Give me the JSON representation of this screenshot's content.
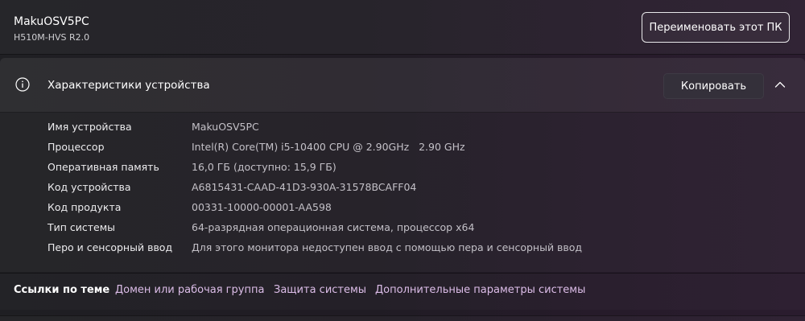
{
  "device": {
    "name": "MakuOSV5PC",
    "model": "H510M-HVS R2.0",
    "rename_label": "Переименовать этот ПК"
  },
  "specs": {
    "title": "Характеристики устройства",
    "copy_label": "Копировать",
    "expanded": true,
    "rows": [
      {
        "label": "Имя устройства",
        "value": "MakuOSV5PC"
      },
      {
        "label": "Процессор",
        "value": "Intel(R) Core(TM) i5-10400 CPU @ 2.90GHz   2.90 GHz"
      },
      {
        "label": "Оперативная память",
        "value": "16,0 ГБ (доступно: 15,9 ГБ)"
      },
      {
        "label": "Код устройства",
        "value": "A6815431-CAAD-41D3-930A-31578BCAFF04"
      },
      {
        "label": "Код продукта",
        "value": "00331-10000-00001-AA598"
      },
      {
        "label": "Тип системы",
        "value": "64-разрядная операционная система, процессор x64"
      },
      {
        "label": "Перо и сенсорный ввод",
        "value": "Для этого монитора недоступен ввод с помощью пера и сенсорный ввод"
      }
    ]
  },
  "related": {
    "title": "Ссылки по теме",
    "links": [
      {
        "label": "Домен или рабочая группа"
      },
      {
        "label": "Защита системы"
      },
      {
        "label": "Дополнительные параметры системы"
      }
    ]
  },
  "colors": {
    "link": "#dcbde8",
    "value_text": "#c3c0c7",
    "button_bg": "#34303a"
  },
  "icons": {
    "spec_header": "info-icon",
    "collapse": "chevron-up-icon"
  }
}
